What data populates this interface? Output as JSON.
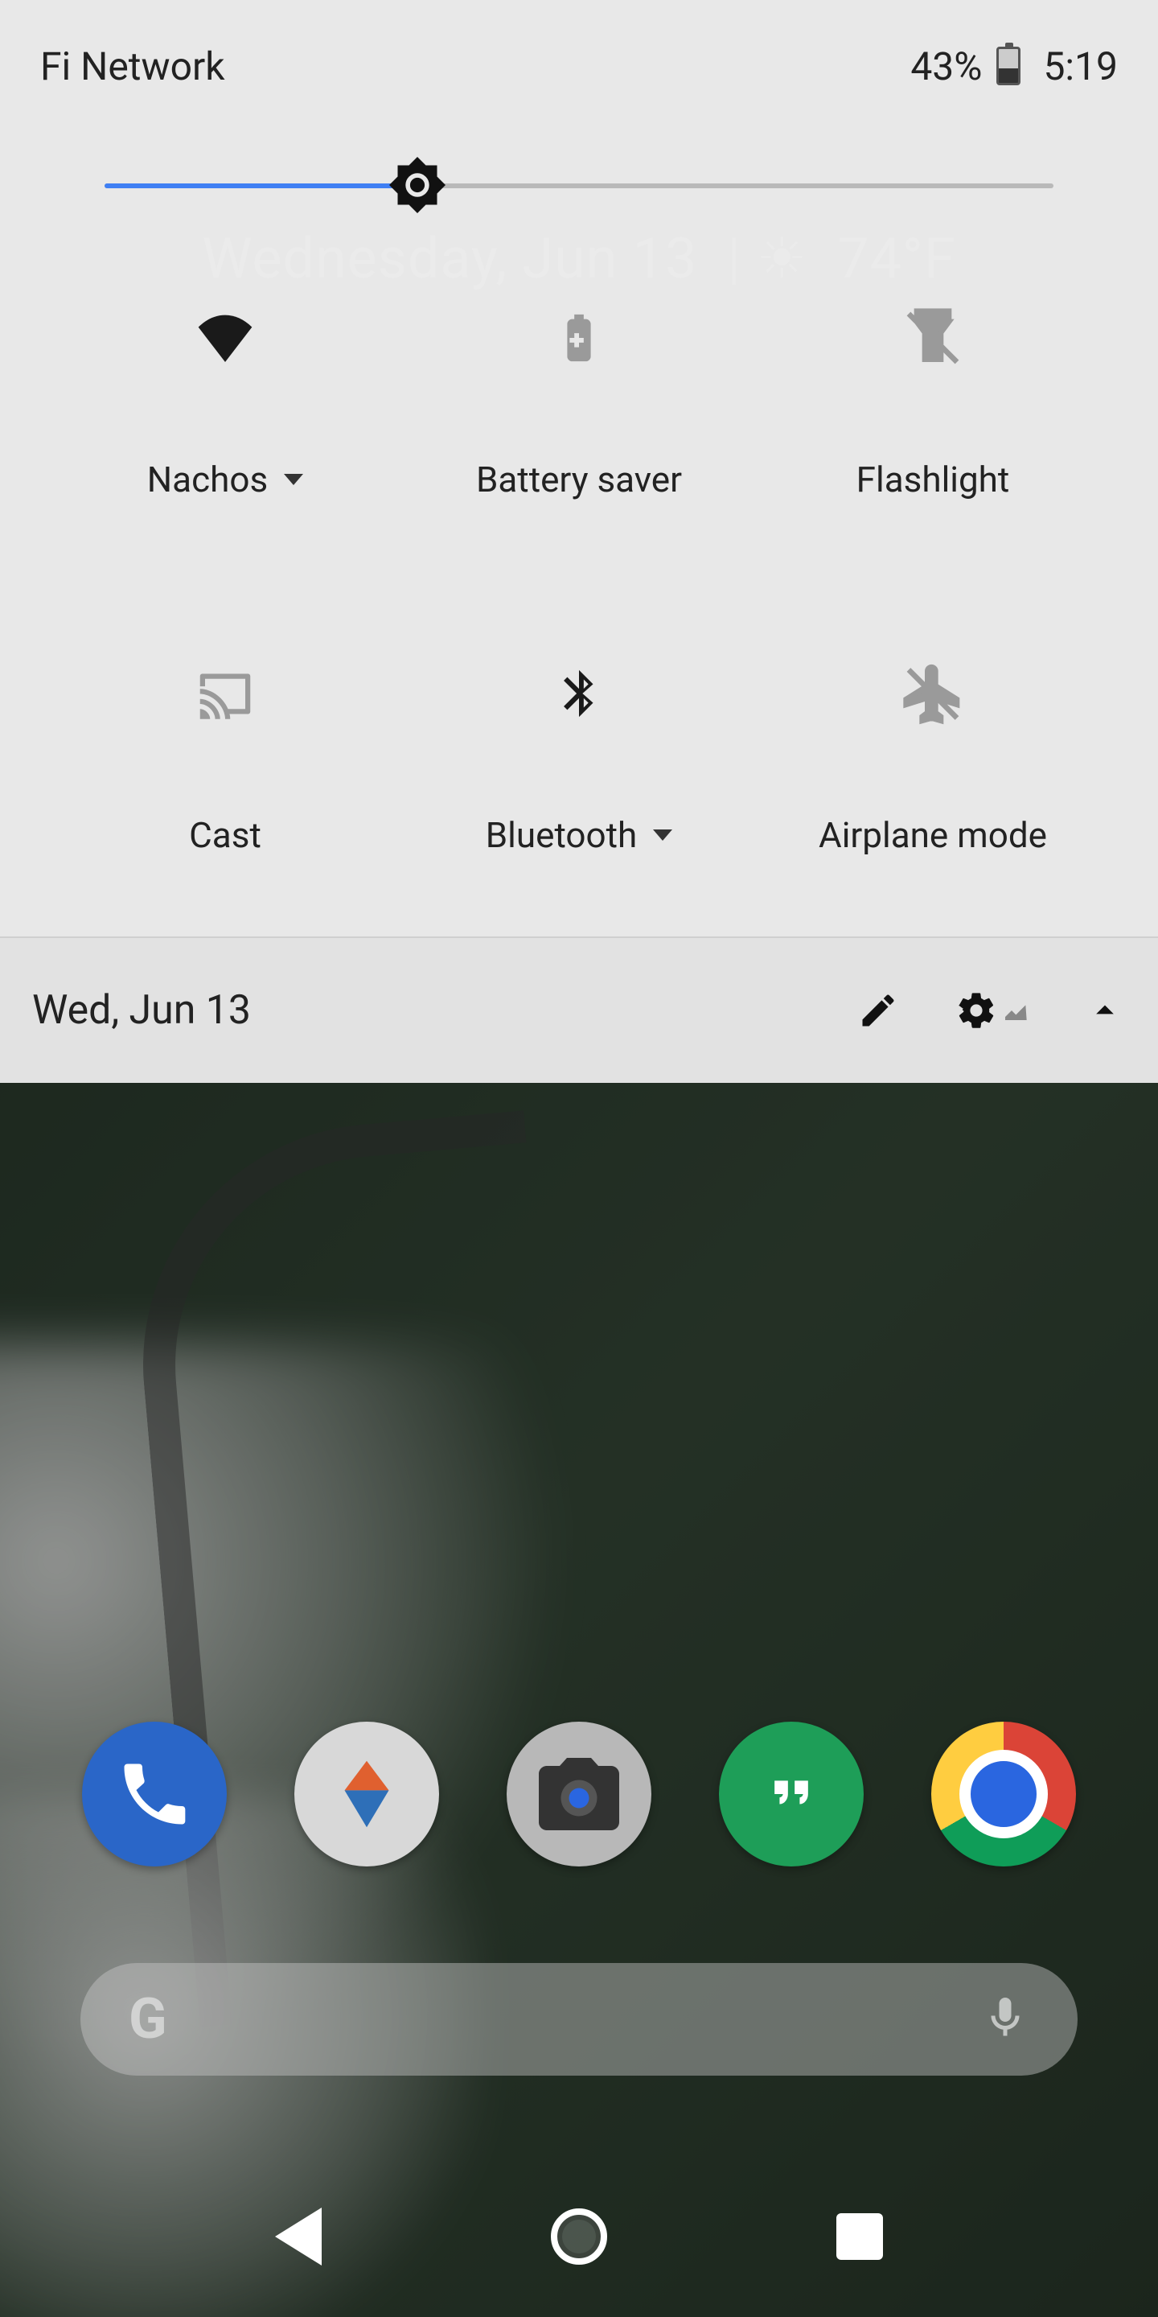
{
  "status_bar": {
    "carrier": "Fi Network",
    "battery_percent": "43%",
    "time": "5:19"
  },
  "brightness": {
    "percent": 33
  },
  "home_widget": {
    "date_full": "Wednesday, Jun 13",
    "temperature": "74°F"
  },
  "tiles": [
    {
      "id": "wifi",
      "label": "Nachos",
      "has_caret": true,
      "active": true,
      "icon": "wifi-icon"
    },
    {
      "id": "battery-saver",
      "label": "Battery saver",
      "has_caret": false,
      "active": false,
      "icon": "battery-saver-icon"
    },
    {
      "id": "flashlight",
      "label": "Flashlight",
      "has_caret": false,
      "active": false,
      "icon": "flashlight-icon"
    },
    {
      "id": "cast",
      "label": "Cast",
      "has_caret": false,
      "active": false,
      "icon": "cast-icon"
    },
    {
      "id": "bluetooth",
      "label": "Bluetooth",
      "has_caret": true,
      "active": true,
      "icon": "bluetooth-icon"
    },
    {
      "id": "airplane",
      "label": "Airplane mode",
      "has_caret": false,
      "active": false,
      "icon": "airplane-icon"
    }
  ],
  "qs_footer": {
    "date": "Wed, Jun 13"
  },
  "dock": [
    {
      "id": "phone",
      "name": "Phone"
    },
    {
      "id": "nav",
      "name": "Nova Settings"
    },
    {
      "id": "camera",
      "name": "Camera"
    },
    {
      "id": "hangouts",
      "name": "Hangouts"
    },
    {
      "id": "chrome",
      "name": "Chrome"
    }
  ]
}
